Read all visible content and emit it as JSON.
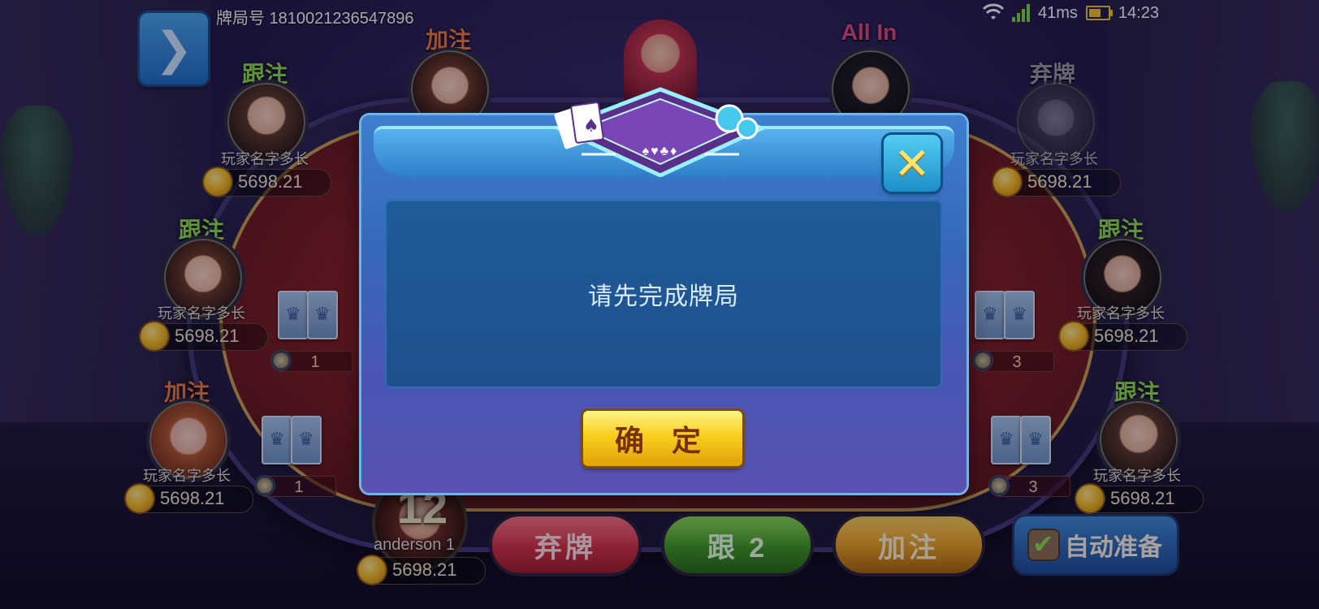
{
  "status_bar": {
    "game_id_label": "牌局号 1810021236547896",
    "ping": "41ms",
    "time": "14:23"
  },
  "menu": {
    "icon": "chevron-right-icon"
  },
  "players": [
    {
      "action": "跟注",
      "action_type": "call",
      "name": "玩家名字多长",
      "coins": "5698.21"
    },
    {
      "action": "加注",
      "action_type": "raise",
      "name": "",
      "coins": ""
    },
    {
      "action": "All In",
      "action_type": "allin",
      "name": "",
      "coins": ""
    },
    {
      "action": "弃牌",
      "action_type": "fold",
      "name": "玩家名字多长",
      "coins": "5698.21"
    },
    {
      "action": "跟注",
      "action_type": "call",
      "name": "玩家名字多长",
      "coins": "5698.21"
    },
    {
      "action": "跟注",
      "action_type": "call",
      "name": "玩家名字多长",
      "coins": "5698.21"
    },
    {
      "action": "加注",
      "action_type": "raise",
      "name": "玩家名字多长",
      "coins": "5698.21"
    },
    {
      "action": "跟注",
      "action_type": "call",
      "name": "玩家名字多长",
      "coins": "5698.21"
    }
  ],
  "chip_counts": [
    "1",
    "1",
    "3",
    "3"
  ],
  "own_player": {
    "countdown": "12",
    "name": "anderson 1",
    "coins": "5698.21"
  },
  "actions": {
    "fold": "弃牌",
    "call": "跟 2",
    "raise": "加注",
    "auto_ready": "自动准备"
  },
  "modal": {
    "suits": "♠♥♣♦",
    "message": "请先完成牌局",
    "confirm": "确 定",
    "close_icon": "close-icon"
  },
  "colors": {
    "modal_bg": "#3768b8",
    "confirm_btn": "#f7cf1c",
    "fold_btn": "#d5313f",
    "call_btn": "#3e9a1e",
    "raise_btn": "#e79e1a"
  }
}
